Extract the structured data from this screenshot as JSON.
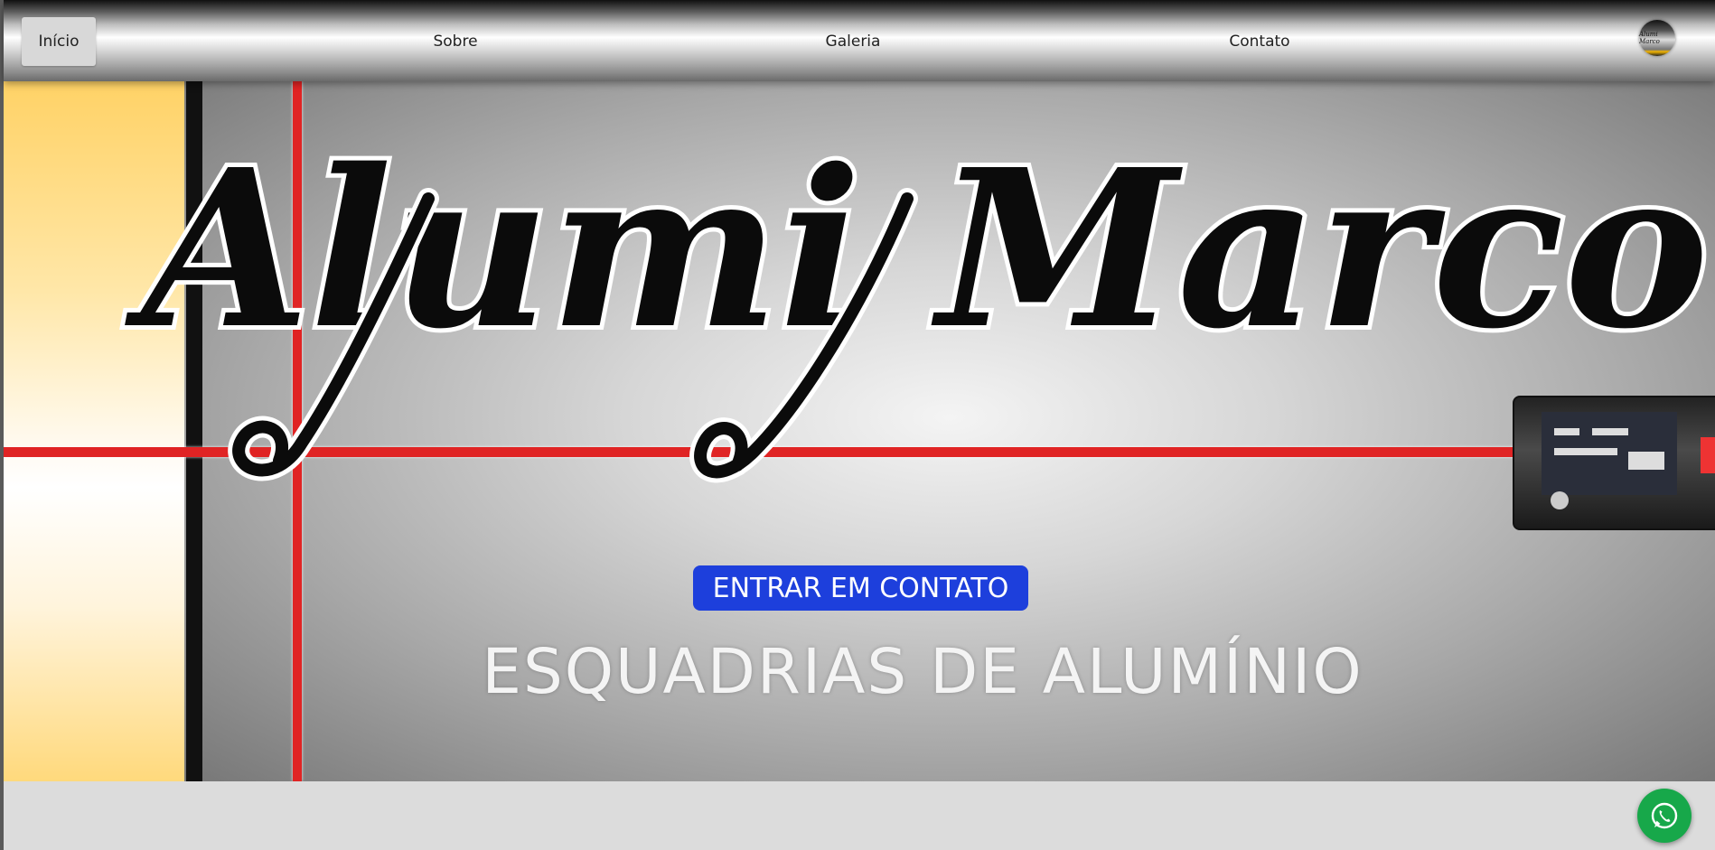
{
  "nav": {
    "items": [
      {
        "label": "Início",
        "active": true
      },
      {
        "label": "Sobre"
      },
      {
        "label": "Galeria"
      },
      {
        "label": "Contato"
      }
    ],
    "logo_text": "Alumi Marco"
  },
  "hero": {
    "brand": "Alumi Marco",
    "tagline": "ESQUADRIAS DE ALUMÍNIO",
    "cta_label": "ENTRAR EM CONTATO"
  },
  "floating": {
    "whatsapp_icon": "whatsapp-icon"
  },
  "colors": {
    "cta": "#1d3fdc",
    "whatsapp": "#17a84a",
    "accent_red": "#e02424"
  }
}
